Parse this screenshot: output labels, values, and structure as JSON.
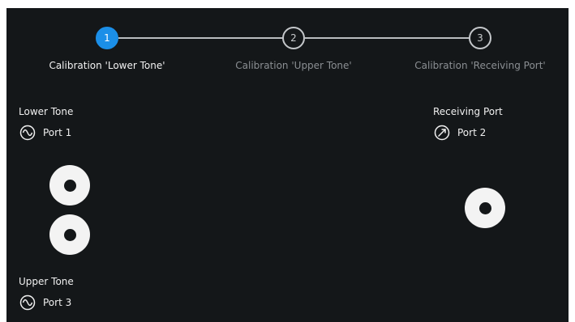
{
  "stepper": {
    "steps": [
      {
        "number": "1",
        "label": "Calibration 'Lower Tone'",
        "active": true
      },
      {
        "number": "2",
        "label": "Calibration 'Upper Tone'",
        "active": false
      },
      {
        "number": "3",
        "label": "Calibration 'Receiving Port'",
        "active": false
      }
    ]
  },
  "lower_tone": {
    "title": "Lower Tone",
    "port_icon": "sine-wave-icon",
    "port_label": "Port 1"
  },
  "upper_tone": {
    "title": "Upper Tone",
    "port_icon": "sine-wave-icon",
    "port_label": "Port 3"
  },
  "receiving_port": {
    "title": "Receiving Port",
    "port_icon": "gauge-arrow-icon",
    "port_label": "Port 2"
  },
  "colors": {
    "background": "#141719",
    "accent": "#1b8fe8",
    "connector": "#f3f3f3"
  }
}
